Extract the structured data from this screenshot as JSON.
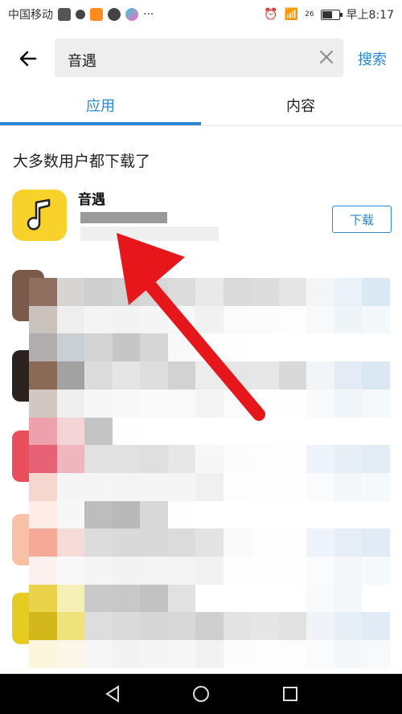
{
  "status_bar": {
    "carrier": "中国移动",
    "time": "早上8:17",
    "signal_label": "26"
  },
  "header": {
    "query": "音遇",
    "search_label": "搜索"
  },
  "tabs": [
    {
      "label": "应用",
      "active": true
    },
    {
      "label": "内容",
      "active": false
    }
  ],
  "section_title": "大多数用户都下载了",
  "apps": [
    {
      "name": "音遇",
      "download_label": "下载",
      "icon_color": "#f8d12a"
    }
  ],
  "colors": {
    "accent": "#2a86d1",
    "arrow": "#e5171b"
  }
}
